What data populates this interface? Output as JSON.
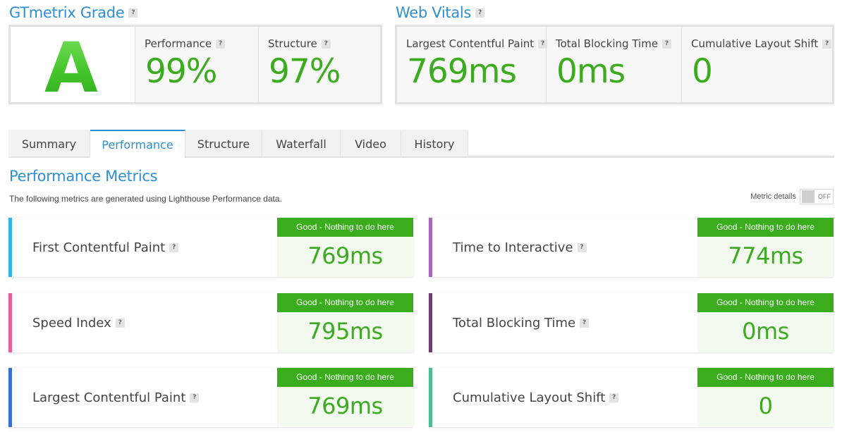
{
  "grade": {
    "title": "GTmetrix Grade",
    "letter": "A",
    "performance_label": "Performance",
    "performance_value": "99%",
    "structure_label": "Structure",
    "structure_value": "97%"
  },
  "web_vitals": {
    "title": "Web Vitals",
    "lcp_label": "Largest Contentful Paint",
    "lcp_value": "769ms",
    "tbt_label": "Total Blocking Time",
    "tbt_value": "0ms",
    "cls_label": "Cumulative Layout Shift",
    "cls_value": "0"
  },
  "help_glyph": "?",
  "tabs": [
    {
      "label": "Summary"
    },
    {
      "label": "Performance"
    },
    {
      "label": "Structure"
    },
    {
      "label": "Waterfall"
    },
    {
      "label": "Video"
    },
    {
      "label": "History"
    }
  ],
  "active_tab": "Performance",
  "metrics_section": {
    "title": "Performance Metrics",
    "description": "The following metrics are generated using Lighthouse Performance data.",
    "details_label": "Metric details",
    "toggle_state": "OFF"
  },
  "metrics": [
    {
      "label": "First Contentful Paint",
      "status": "Good - Nothing to do here",
      "value": "769ms",
      "color": "#2eb6e8"
    },
    {
      "label": "Time to Interactive",
      "status": "Good - Nothing to do here",
      "value": "774ms",
      "color": "#a569bd"
    },
    {
      "label": "Speed Index",
      "status": "Good - Nothing to do here",
      "value": "795ms",
      "color": "#e5609a"
    },
    {
      "label": "Total Blocking Time",
      "status": "Good - Nothing to do here",
      "value": "0ms",
      "color": "#6b3d6e"
    },
    {
      "label": "Largest Contentful Paint",
      "status": "Good - Nothing to do here",
      "value": "769ms",
      "color": "#3b6fd6"
    },
    {
      "label": "Cumulative Layout Shift",
      "status": "Good - Nothing to do here",
      "value": "0",
      "color": "#4cbf9a"
    }
  ],
  "colors": {
    "accent": "#2f8fd1",
    "good": "#3aac1e"
  }
}
